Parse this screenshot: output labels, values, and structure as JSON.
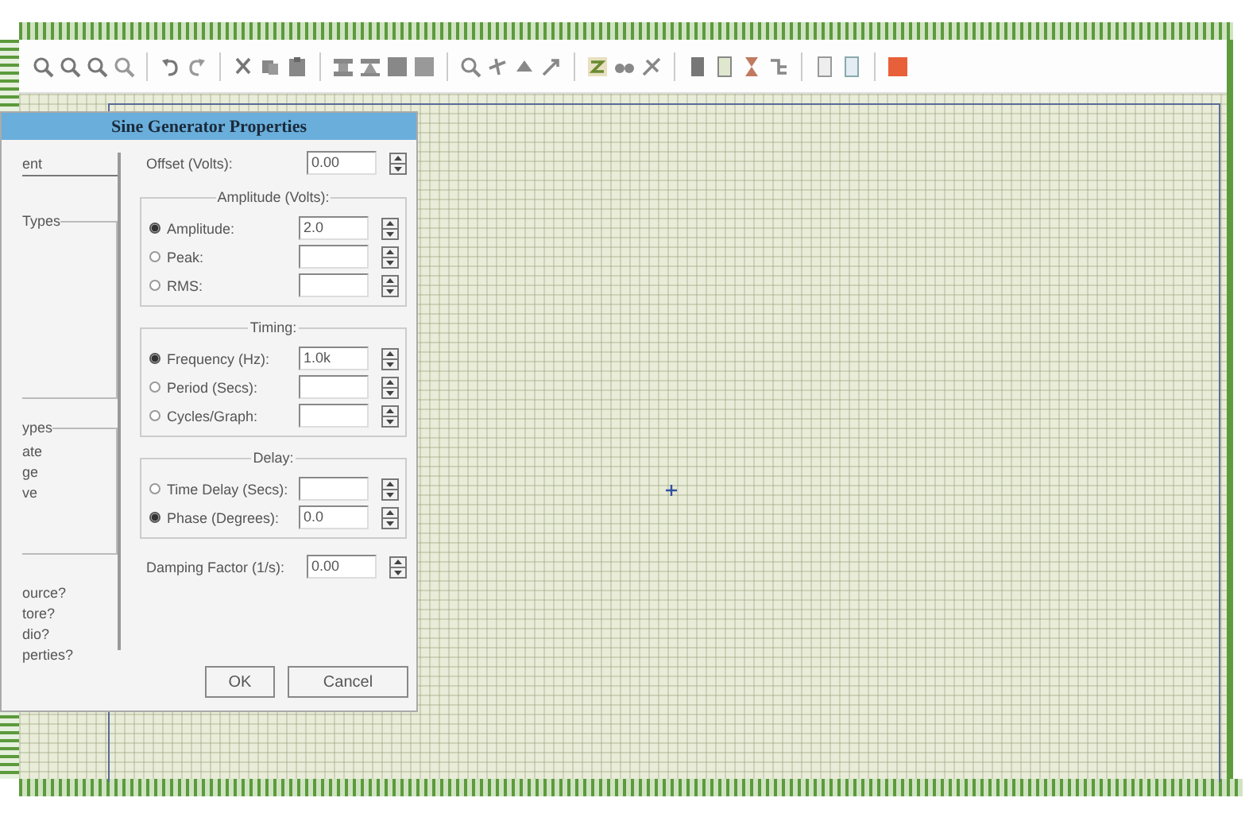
{
  "dialog": {
    "title": "Sine Generator Properties",
    "left_panel": {
      "field_label": "ent",
      "group_1_title": "Types",
      "group_2_title": "ypes",
      "group_2_items": [
        "ate",
        "ge",
        "ve"
      ],
      "questions": [
        "ource?",
        "tore?",
        "dio?",
        "perties?"
      ]
    },
    "offset": {
      "label": "Offset (Volts):",
      "value": "0.00"
    },
    "groups": [
      {
        "title": "Amplitude (Volts):",
        "options": [
          {
            "label": "Amplitude:",
            "selected": true,
            "value": "2.0"
          },
          {
            "label": "Peak:",
            "selected": false
          },
          {
            "label": "RMS:",
            "selected": false
          }
        ]
      },
      {
        "title": "Timing:",
        "options": [
          {
            "label": "Frequency (Hz):",
            "selected": true,
            "value": "1.0k"
          },
          {
            "label": "Period (Secs):",
            "selected": false
          },
          {
            "label": "Cycles/Graph:",
            "selected": false
          }
        ]
      },
      {
        "title": "Delay:",
        "options": [
          {
            "label": "Time Delay (Secs):",
            "selected": false
          },
          {
            "label": "Phase (Degrees):",
            "selected": true,
            "value": "0.0"
          }
        ]
      }
    ],
    "damping": {
      "label": "Damping Factor (1/s):",
      "value": "0.00"
    },
    "buttons": [
      "OK",
      "Cancel"
    ]
  }
}
